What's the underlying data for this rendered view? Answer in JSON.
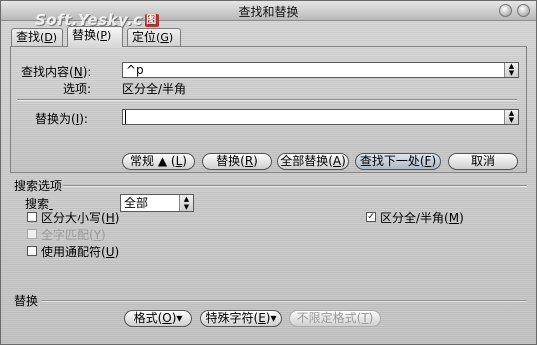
{
  "window": {
    "title": "查找和替换"
  },
  "watermark": {
    "text": "Soft.Yesky.c",
    "box": "🕮"
  },
  "tabs": [
    {
      "label": "查找",
      "key": "D"
    },
    {
      "label": "替换",
      "key": "P"
    },
    {
      "label": "定位",
      "key": "G"
    }
  ],
  "find": {
    "label": "查找内容",
    "key": "N",
    "value": "^p"
  },
  "options_line": {
    "label": "选项:",
    "value": "区分全/半角"
  },
  "replace": {
    "label": "替换为",
    "key": "I",
    "value": ""
  },
  "buttons": {
    "normal": {
      "label": "常规 ▲",
      "key": "L"
    },
    "replace": {
      "label": "替换",
      "key": "R"
    },
    "replace_all": {
      "label": "全部替换",
      "key": "A"
    },
    "find_next": {
      "label": "查找下一处",
      "key": "F"
    },
    "cancel": {
      "label": "取消"
    }
  },
  "search_options": {
    "title": "搜索选项",
    "search_label": "搜索",
    "search_value": "全部",
    "match_case": {
      "label": "区分大小写",
      "key": "H",
      "checked": false
    },
    "whole_word": {
      "label": "全字匹配",
      "key": "Y",
      "checked": false,
      "disabled": true
    },
    "wildcards": {
      "label": "使用通配符",
      "key": "U",
      "checked": false
    },
    "match_width": {
      "label": "区分全/半角",
      "key": "M",
      "checked": true
    }
  },
  "replace_section": {
    "title": "替换",
    "format": {
      "label": "格式",
      "key": "O"
    },
    "special": {
      "label": "特殊字符",
      "key": "E"
    },
    "no_format": {
      "label": "不限定格式",
      "key": "T"
    }
  }
}
